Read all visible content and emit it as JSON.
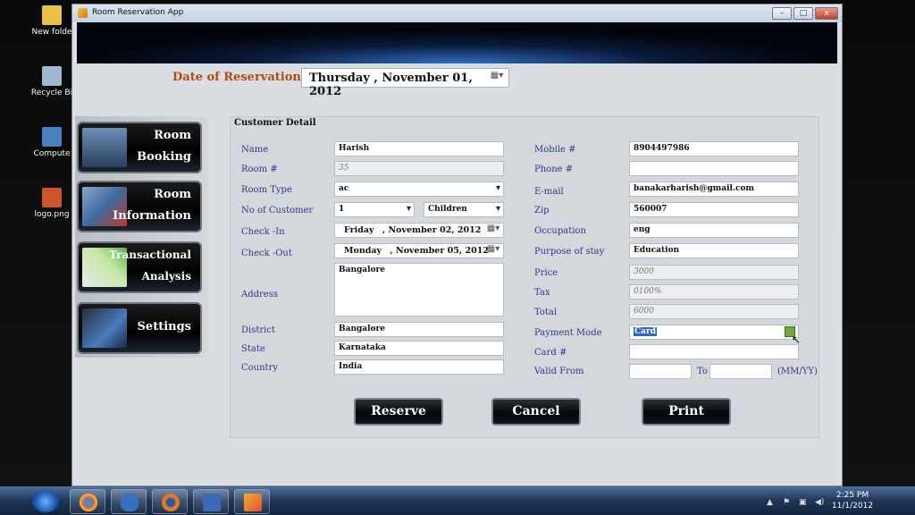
{
  "desktop": {
    "icons": [
      {
        "label": "New folde",
        "color": "#e9c04a"
      },
      {
        "label": "Recycle Bi",
        "color": "#9fb7cf"
      },
      {
        "label": "Compute",
        "color": "#4a7fc0"
      },
      {
        "label": "logo.png",
        "color": "#d0542b"
      }
    ]
  },
  "window": {
    "title": "Room Reservation App",
    "controls": {
      "minimize": "–",
      "maximize": "□",
      "close": "x"
    }
  },
  "reservation": {
    "date_label": "Date of Reservation :",
    "date_value": "Thursday , November 01, 2012"
  },
  "nav": [
    {
      "line1": "Room",
      "line2": "Booking"
    },
    {
      "line1": "Room",
      "line2": "Information"
    },
    {
      "line1": "Transactional",
      "line2": "Analysis"
    },
    {
      "line1": "",
      "line2": "Settings"
    }
  ],
  "form": {
    "section_title": "Customer Detail",
    "left": {
      "name": {
        "label": "Name",
        "value": "Harish"
      },
      "room_no": {
        "label": "Room #",
        "value": "35"
      },
      "room_type": {
        "label": "Room Type",
        "value": "ac"
      },
      "no_customer": {
        "label": "No of Customer",
        "value": "1",
        "children": "Children"
      },
      "check_in": {
        "label": "Check -In",
        "day": "Friday",
        "date": ", November 02, 2012"
      },
      "check_out": {
        "label": "Check -Out",
        "day": "Monday",
        "date": ", November 05, 2012"
      },
      "address": {
        "label": "Address",
        "value": "Bangalore"
      },
      "district": {
        "label": "District",
        "value": "Bangalore"
      },
      "state": {
        "label": "State",
        "value": "Karnataka"
      },
      "country": {
        "label": "Country",
        "value": "India"
      }
    },
    "right": {
      "mobile": {
        "label": "Mobile #",
        "value": "8904497986"
      },
      "phone": {
        "label": "Phone #",
        "value": ""
      },
      "email": {
        "label": "E-mail",
        "value": "banakarharish@gmail.com"
      },
      "zip": {
        "label": "Zip",
        "value": "560007"
      },
      "occupation": {
        "label": "Occupation",
        "value": "eng"
      },
      "purpose": {
        "label": "Purpose of stay",
        "value": "Education"
      },
      "price": {
        "label": "Price",
        "value": "3000"
      },
      "tax": {
        "label": "Tax",
        "value": "0100%"
      },
      "total": {
        "label": "Total",
        "value": "6000"
      },
      "payment_mode": {
        "label": "Payment Mode",
        "value": "Card"
      },
      "card_no": {
        "label": "Card #",
        "value": ""
      },
      "valid_from": {
        "label": "Valid From",
        "to_label": "To",
        "format": "(MM/YY)"
      }
    },
    "buttons": {
      "reserve": "Reserve",
      "cancel": "Cancel",
      "print": "Print"
    }
  },
  "taskbar": {
    "time": "2:25 PM",
    "date": "11/1/2012",
    "items": [
      {
        "name": "chrome",
        "color": "#d84a3a"
      },
      {
        "name": "infinity",
        "color": "#3a6fc0"
      },
      {
        "name": "firefox",
        "color": "#e07a22"
      },
      {
        "name": "save",
        "color": "#3c69b8"
      },
      {
        "name": "app",
        "color": "#f0b030"
      }
    ]
  }
}
